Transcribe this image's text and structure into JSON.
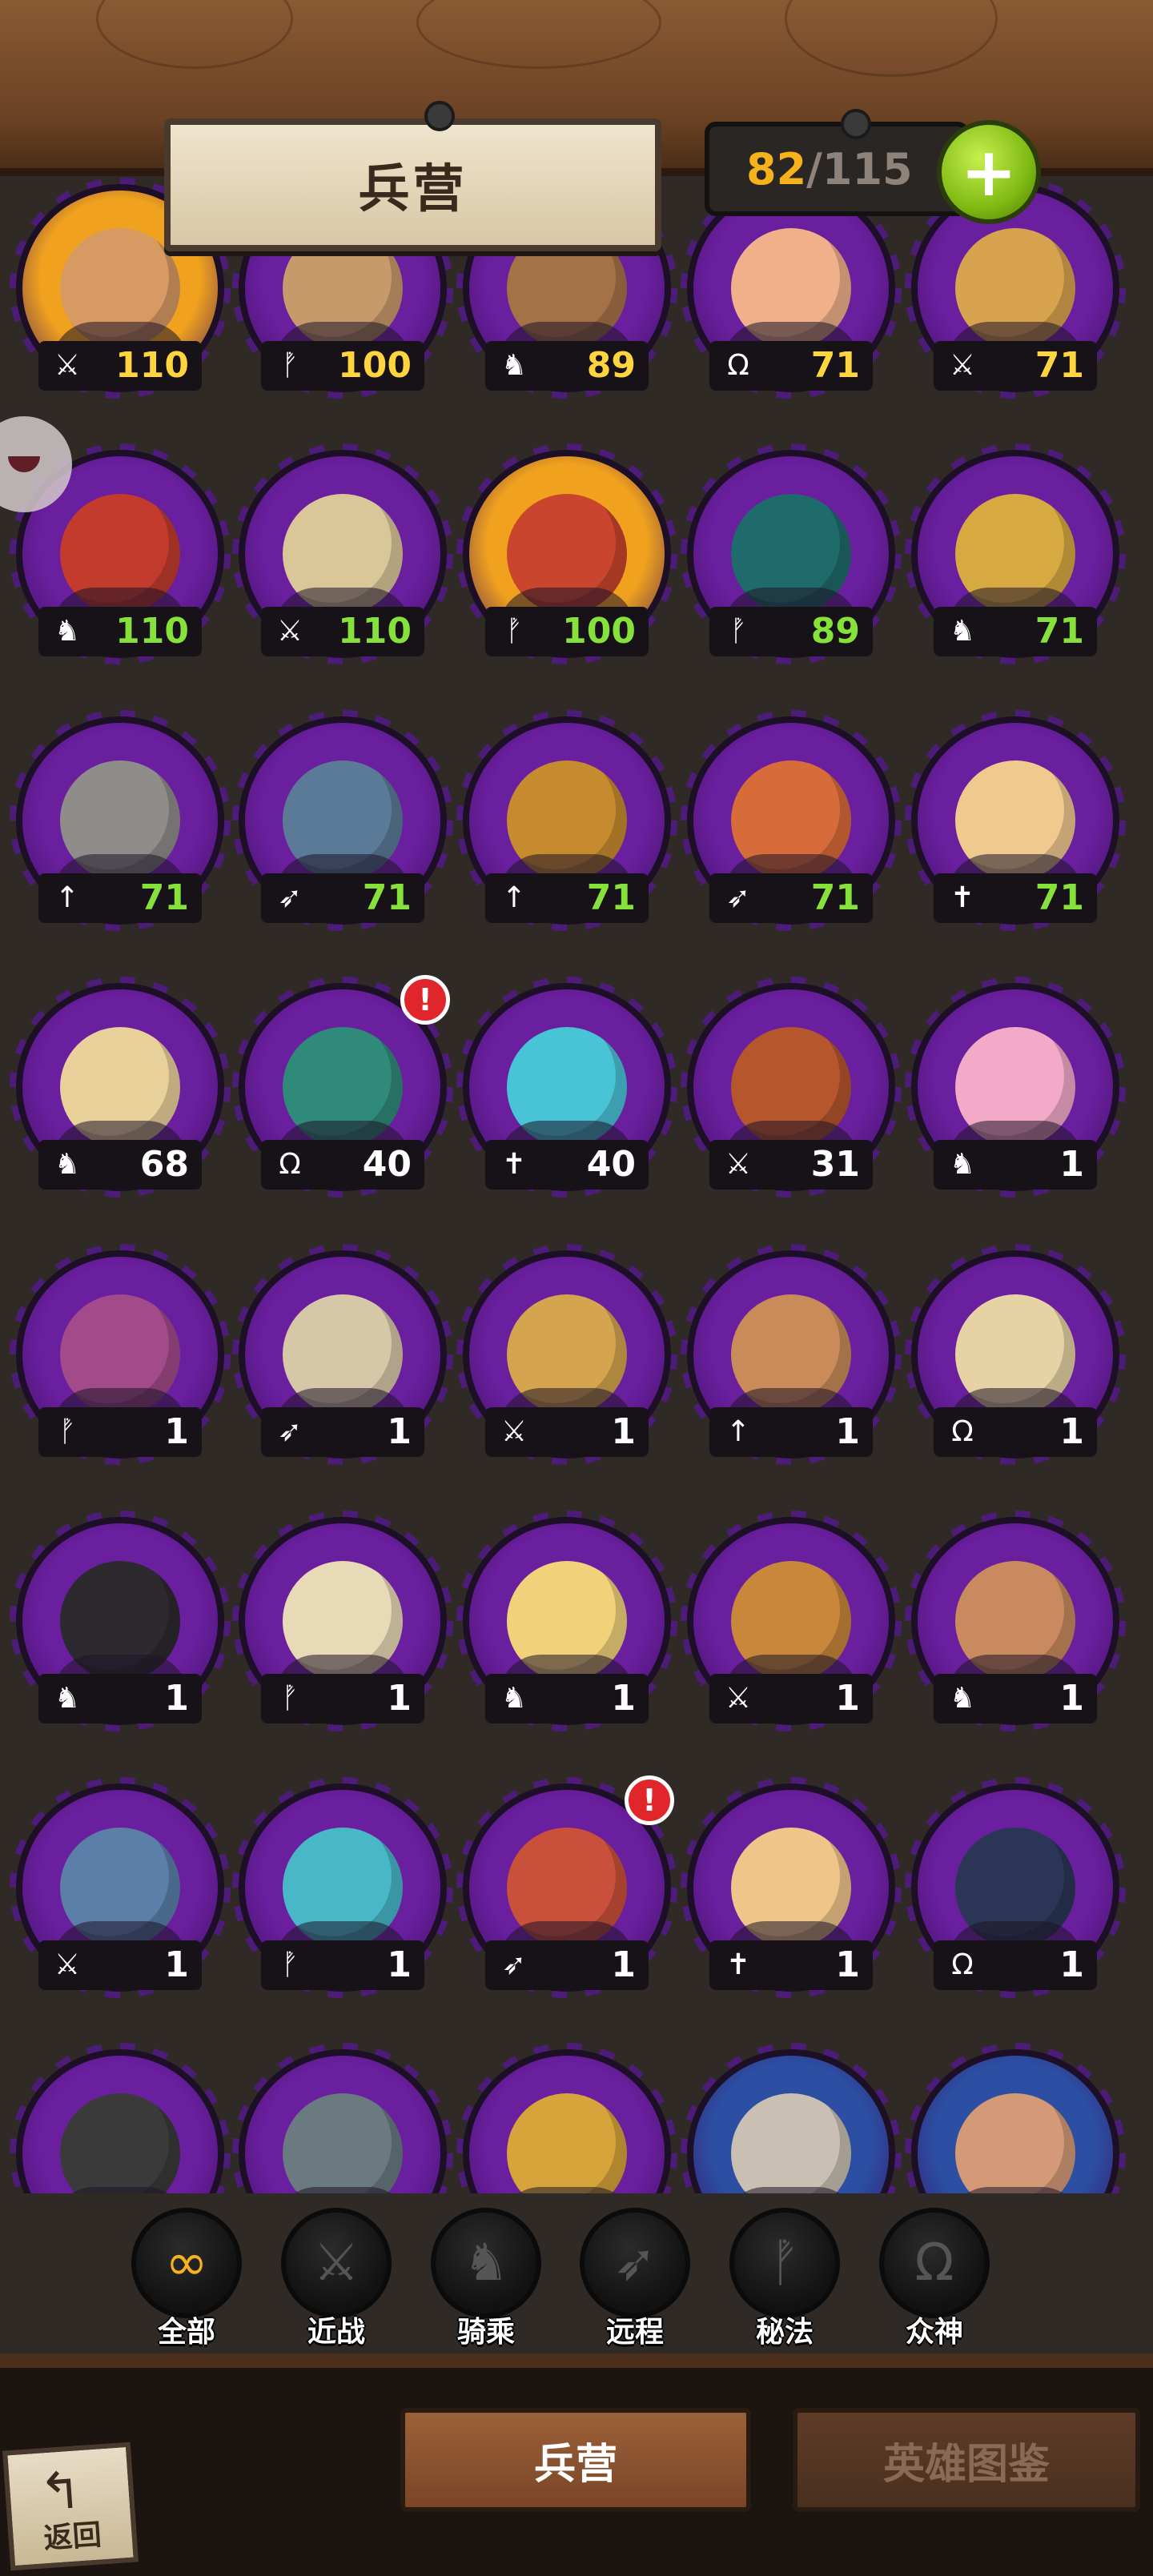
{
  "header": {
    "title": "兵营",
    "count_current": "82",
    "count_separator": "/",
    "count_max": "115",
    "add_label": "+"
  },
  "colors": {
    "purple_card": "#6a1f9e",
    "gold_card": "#f0a21e",
    "blue_card": "#2c4fa3",
    "level_yellow": "#ffd53f",
    "level_green": "#86e23a",
    "level_white": "#ffffff",
    "alert_red": "#e0262b"
  },
  "units": [
    {
      "name": "unit-1",
      "class": "melee",
      "cls_icon": "⚔",
      "level": "110",
      "frame": "gold",
      "level_color": "yellow",
      "face": "#d89a63",
      "alert": false
    },
    {
      "name": "unit-2",
      "class": "arcane",
      "cls_icon": "ᚡ",
      "level": "100",
      "frame": "purple",
      "level_color": "yellow",
      "face": "#c79a6c",
      "alert": false
    },
    {
      "name": "unit-3",
      "class": "mounted",
      "cls_icon": "♞",
      "level": "89",
      "frame": "purple",
      "level_color": "yellow",
      "face": "#a57248",
      "alert": false
    },
    {
      "name": "unit-4",
      "class": "divine",
      "cls_icon": "Ω",
      "level": "71",
      "frame": "purple",
      "level_color": "yellow",
      "face": "#f0b08a",
      "alert": false
    },
    {
      "name": "unit-5",
      "class": "melee",
      "cls_icon": "⚔",
      "level": "71",
      "frame": "purple",
      "level_color": "yellow",
      "face": "#d8a34f",
      "alert": false
    },
    {
      "name": "unit-6",
      "class": "mounted",
      "cls_icon": "♞",
      "level": "110",
      "frame": "purple",
      "level_color": "green",
      "face": "#c23b2c",
      "alert": false
    },
    {
      "name": "unit-7",
      "class": "melee",
      "cls_icon": "⚔",
      "level": "110",
      "frame": "purple",
      "level_color": "green",
      "face": "#d9c79a",
      "alert": false
    },
    {
      "name": "unit-8",
      "class": "arcane",
      "cls_icon": "ᚡ",
      "level": "100",
      "frame": "gold",
      "level_color": "green",
      "face": "#c9452e",
      "alert": false
    },
    {
      "name": "unit-9",
      "class": "arcane",
      "cls_icon": "ᚡ",
      "level": "89",
      "frame": "purple",
      "level_color": "green",
      "face": "#1f6a6b",
      "alert": false
    },
    {
      "name": "unit-10",
      "class": "mounted",
      "cls_icon": "♞",
      "level": "71",
      "frame": "purple",
      "level_color": "green",
      "face": "#d7a941",
      "alert": false
    },
    {
      "name": "unit-11",
      "class": "spear",
      "cls_icon": "↑",
      "level": "71",
      "frame": "purple",
      "level_color": "green",
      "face": "#8f8d8a",
      "alert": false
    },
    {
      "name": "unit-12",
      "class": "ranged",
      "cls_icon": "➶",
      "level": "71",
      "frame": "purple",
      "level_color": "green",
      "face": "#5b7a98",
      "alert": false
    },
    {
      "name": "unit-13",
      "class": "spear",
      "cls_icon": "↑",
      "level": "71",
      "frame": "purple",
      "level_color": "green",
      "face": "#c78b2f",
      "alert": false
    },
    {
      "name": "unit-14",
      "class": "ranged",
      "cls_icon": "➶",
      "level": "71",
      "frame": "purple",
      "level_color": "green",
      "face": "#d86b3a",
      "alert": false
    },
    {
      "name": "unit-15",
      "class": "healer",
      "cls_icon": "✝",
      "level": "71",
      "frame": "purple",
      "level_color": "green",
      "face": "#f0c98f",
      "alert": false
    },
    {
      "name": "unit-16",
      "class": "mounted",
      "cls_icon": "♞",
      "level": "68",
      "frame": "purple",
      "level_color": "white",
      "face": "#e9d19b",
      "alert": false
    },
    {
      "name": "unit-17",
      "class": "divine",
      "cls_icon": "Ω",
      "level": "40",
      "frame": "purple",
      "level_color": "white",
      "face": "#2f8a7a",
      "alert": true
    },
    {
      "name": "unit-18",
      "class": "healer",
      "cls_icon": "✝",
      "level": "40",
      "frame": "purple",
      "level_color": "white",
      "face": "#49c3d6",
      "alert": false
    },
    {
      "name": "unit-19",
      "class": "melee",
      "cls_icon": "⚔",
      "level": "31",
      "frame": "purple",
      "level_color": "white",
      "face": "#b5562d",
      "alert": false
    },
    {
      "name": "unit-20",
      "class": "mounted",
      "cls_icon": "♞",
      "level": "1",
      "frame": "purple",
      "level_color": "white",
      "face": "#f3a9c8",
      "alert": false
    },
    {
      "name": "unit-21",
      "class": "arcane",
      "cls_icon": "ᚡ",
      "level": "1",
      "frame": "purple",
      "level_color": "white",
      "face": "#a34a8a",
      "alert": false
    },
    {
      "name": "unit-22",
      "class": "ranged",
      "cls_icon": "➶",
      "level": "1",
      "frame": "purple",
      "level_color": "white",
      "face": "#d6c7a8",
      "alert": false
    },
    {
      "name": "unit-23",
      "class": "melee",
      "cls_icon": "⚔",
      "level": "1",
      "frame": "purple",
      "level_color": "white",
      "face": "#d4a44f",
      "alert": false
    },
    {
      "name": "unit-24",
      "class": "spear",
      "cls_icon": "↑",
      "level": "1",
      "frame": "purple",
      "level_color": "white",
      "face": "#c98b5a",
      "alert": false
    },
    {
      "name": "unit-25",
      "class": "divine",
      "cls_icon": "Ω",
      "level": "1",
      "frame": "purple",
      "level_color": "white",
      "face": "#e6d2a4",
      "alert": false
    },
    {
      "name": "unit-26",
      "class": "mounted",
      "cls_icon": "♞",
      "level": "1",
      "frame": "purple",
      "level_color": "white",
      "face": "#2c2a2f",
      "alert": false
    },
    {
      "name": "unit-27",
      "class": "arcane",
      "cls_icon": "ᚡ",
      "level": "1",
      "frame": "purple",
      "level_color": "white",
      "face": "#e8d9b7",
      "alert": false
    },
    {
      "name": "unit-28",
      "class": "mounted",
      "cls_icon": "♞",
      "level": "1",
      "frame": "purple",
      "level_color": "white",
      "face": "#f1d27b",
      "alert": false
    },
    {
      "name": "unit-29",
      "class": "melee",
      "cls_icon": "⚔",
      "level": "1",
      "frame": "purple",
      "level_color": "white",
      "face": "#c9873b",
      "alert": false
    },
    {
      "name": "unit-30",
      "class": "mounted",
      "cls_icon": "♞",
      "level": "1",
      "frame": "purple",
      "level_color": "white",
      "face": "#c88a5e",
      "alert": false
    },
    {
      "name": "unit-31",
      "class": "melee",
      "cls_icon": "⚔",
      "level": "1",
      "frame": "purple",
      "level_color": "white",
      "face": "#5b7fa8",
      "alert": false
    },
    {
      "name": "unit-32",
      "class": "arcane",
      "cls_icon": "ᚡ",
      "level": "1",
      "frame": "purple",
      "level_color": "white",
      "face": "#48b8c9",
      "alert": false
    },
    {
      "name": "unit-33",
      "class": "ranged",
      "cls_icon": "➶",
      "level": "1",
      "frame": "purple",
      "level_color": "white",
      "face": "#c9503a",
      "alert": true
    },
    {
      "name": "unit-34",
      "class": "healer",
      "cls_icon": "✝",
      "level": "1",
      "frame": "purple",
      "level_color": "white",
      "face": "#f0c58a",
      "alert": false
    },
    {
      "name": "unit-35",
      "class": "divine",
      "cls_icon": "Ω",
      "level": "1",
      "frame": "purple",
      "level_color": "white",
      "face": "#2b3656",
      "alert": false
    },
    {
      "name": "unit-36",
      "class": "",
      "cls_icon": "",
      "level": "",
      "frame": "purple",
      "level_color": "white",
      "face": "#3a3a3a",
      "alert": false
    },
    {
      "name": "unit-37",
      "class": "",
      "cls_icon": "",
      "level": "",
      "frame": "purple",
      "level_color": "white",
      "face": "#6a7a80",
      "alert": false
    },
    {
      "name": "unit-38",
      "class": "",
      "cls_icon": "",
      "level": "",
      "frame": "purple",
      "level_color": "white",
      "face": "#d7a33b",
      "alert": false
    },
    {
      "name": "unit-39",
      "class": "",
      "cls_icon": "",
      "level": "",
      "frame": "blue",
      "level_color": "white",
      "face": "#c9c0b3",
      "alert": false
    },
    {
      "name": "unit-40",
      "class": "",
      "cls_icon": "",
      "level": "",
      "frame": "blue",
      "level_color": "white",
      "face": "#d49a78",
      "alert": false
    }
  ],
  "filters": [
    {
      "label": "全部",
      "icon": "∞",
      "icon_name": "infinity-icon",
      "active": true
    },
    {
      "label": "近战",
      "icon": "⚔",
      "icon_name": "sword-icon",
      "active": false
    },
    {
      "label": "骑乘",
      "icon": "♞",
      "icon_name": "horse-icon",
      "active": false
    },
    {
      "label": "远程",
      "icon": "➶",
      "icon_name": "bow-icon",
      "active": false
    },
    {
      "label": "秘法",
      "icon": "ᚡ",
      "icon_name": "rune-icon",
      "active": false
    },
    {
      "label": "众神",
      "icon": "Ω",
      "icon_name": "omega-icon",
      "active": false
    }
  ],
  "bottom_tabs": {
    "barracks": "兵营",
    "hero_codex": "英雄图鉴"
  },
  "back": {
    "label": "返回"
  }
}
